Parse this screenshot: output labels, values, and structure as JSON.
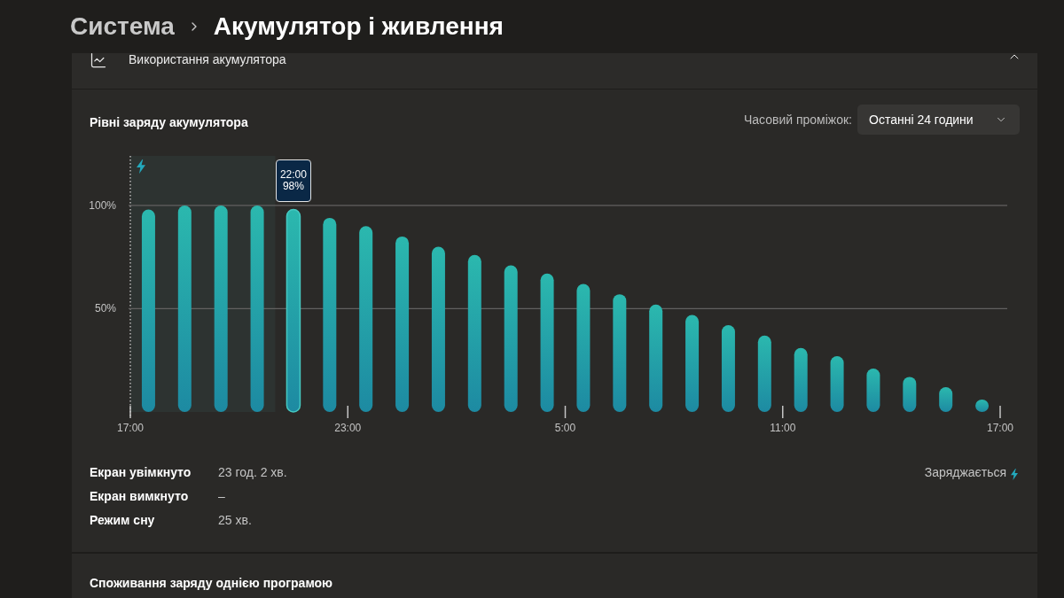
{
  "breadcrumb": [
    {
      "label": "Система",
      "current": false
    },
    {
      "label": "Акумулятор і живлення",
      "current": true
    }
  ],
  "battery_usage": {
    "title": "Використання акумулятора",
    "expanded": true,
    "levels": {
      "title": "Рівні заряду акумулятора",
      "time_range": {
        "label": "Часовий проміжок:",
        "value": "Останні 24 години"
      },
      "chart_data": {
        "type": "bar",
        "ylim": [
          0,
          124
        ],
        "categories": [
          "17:00",
          null,
          null,
          null,
          null,
          null,
          "23:00",
          null,
          null,
          null,
          null,
          null,
          "5:00",
          null,
          null,
          null,
          null,
          null,
          "11:00",
          null,
          null,
          null,
          null,
          null,
          "17:00"
        ],
        "values": [
          98,
          100,
          100,
          100,
          98,
          94,
          90,
          85,
          80,
          76,
          71,
          67,
          62,
          57,
          52,
          47,
          42,
          37,
          31,
          27,
          21,
          17,
          12,
          6,
          null
        ],
        "yticks": [
          {
            "value": 100,
            "label": "100%"
          },
          {
            "value": 50,
            "label": "50%"
          }
        ],
        "annotations": [
          {
            "y": 98,
            "text": "22:00\n98%"
          }
        ]
      }
    },
    "stats": [
      {
        "label": "Екран увімкнуто",
        "value": "23 год. 2 хв."
      },
      {
        "label": "Екран вимкнуто",
        "value": "–"
      },
      {
        "label": "Режим сну",
        "value": "25 хв."
      }
    ],
    "status": {
      "label": "Заряджається",
      "charging": true
    }
  },
  "app_usage": {
    "title": "Споживання заряду однією програмою"
  }
}
